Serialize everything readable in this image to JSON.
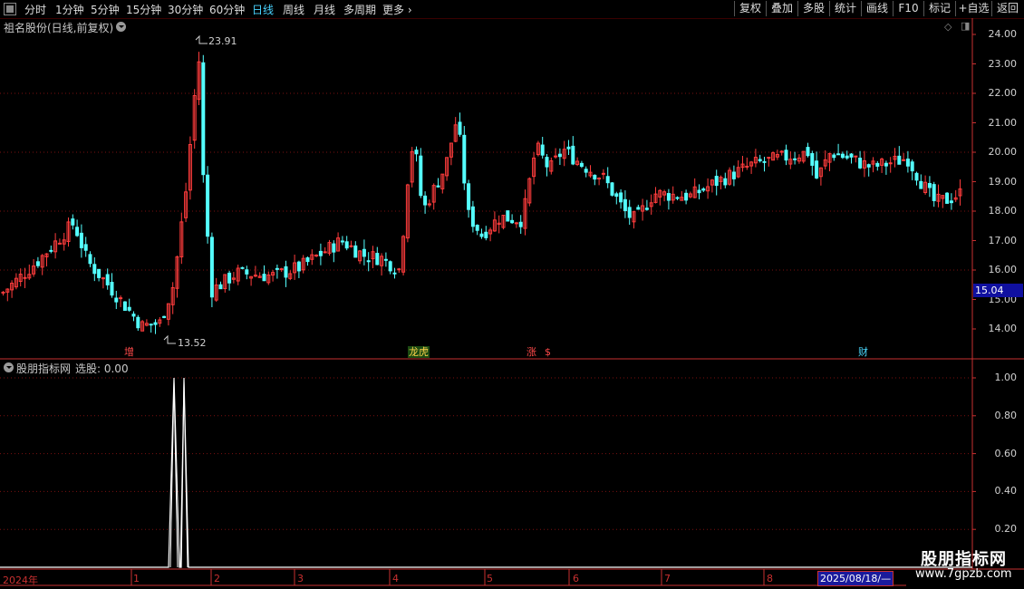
{
  "toolbar": {
    "periods": [
      "分时",
      "1分钟",
      "5分钟",
      "15分钟",
      "30分钟",
      "60分钟",
      "日线",
      "周线",
      "月线",
      "多周期",
      "更多"
    ],
    "active": "日线",
    "right_buttons": [
      "复权",
      "叠加",
      "多股",
      "统计",
      "画线",
      "F10",
      "标记",
      "+自选",
      "返回"
    ]
  },
  "main": {
    "title": "祖名股份(日线,前复权)",
    "y_ticks": [
      "24.00",
      "23.00",
      "22.00",
      "21.00",
      "20.00",
      "19.00",
      "18.00",
      "17.00",
      "16.00",
      "15.00",
      "14.00"
    ],
    "current_price": "15.04",
    "high_mark": "23.91",
    "low_mark": "13.52",
    "events": [
      {
        "text": "增",
        "color": "#ff4a4a"
      },
      {
        "text": "龙虎",
        "color": "#ffd24a"
      },
      {
        "text": "涨",
        "color": "#ff4a4a"
      },
      {
        "text": "$",
        "color": "#ff4a4a"
      },
      {
        "text": "财",
        "color": "#4ad8ff"
      }
    ]
  },
  "indicator": {
    "title": "股朋指标网",
    "value_label": "选股: 0.00",
    "y_ticks": [
      "1.00",
      "0.80",
      "0.60",
      "0.40",
      "0.20"
    ]
  },
  "x_axis": {
    "labels": [
      "2024年",
      "1",
      "2",
      "3",
      "4",
      "5",
      "6",
      "7",
      "8"
    ],
    "cursor_date": "2025/08/18/—"
  },
  "watermark": {
    "title": "股朋指标网",
    "url": "www.7gpzb.com"
  },
  "colors": {
    "up": "#ff3c3c",
    "down": "#54ffff",
    "grid": "#7a1010",
    "axis": "#c83030"
  }
}
